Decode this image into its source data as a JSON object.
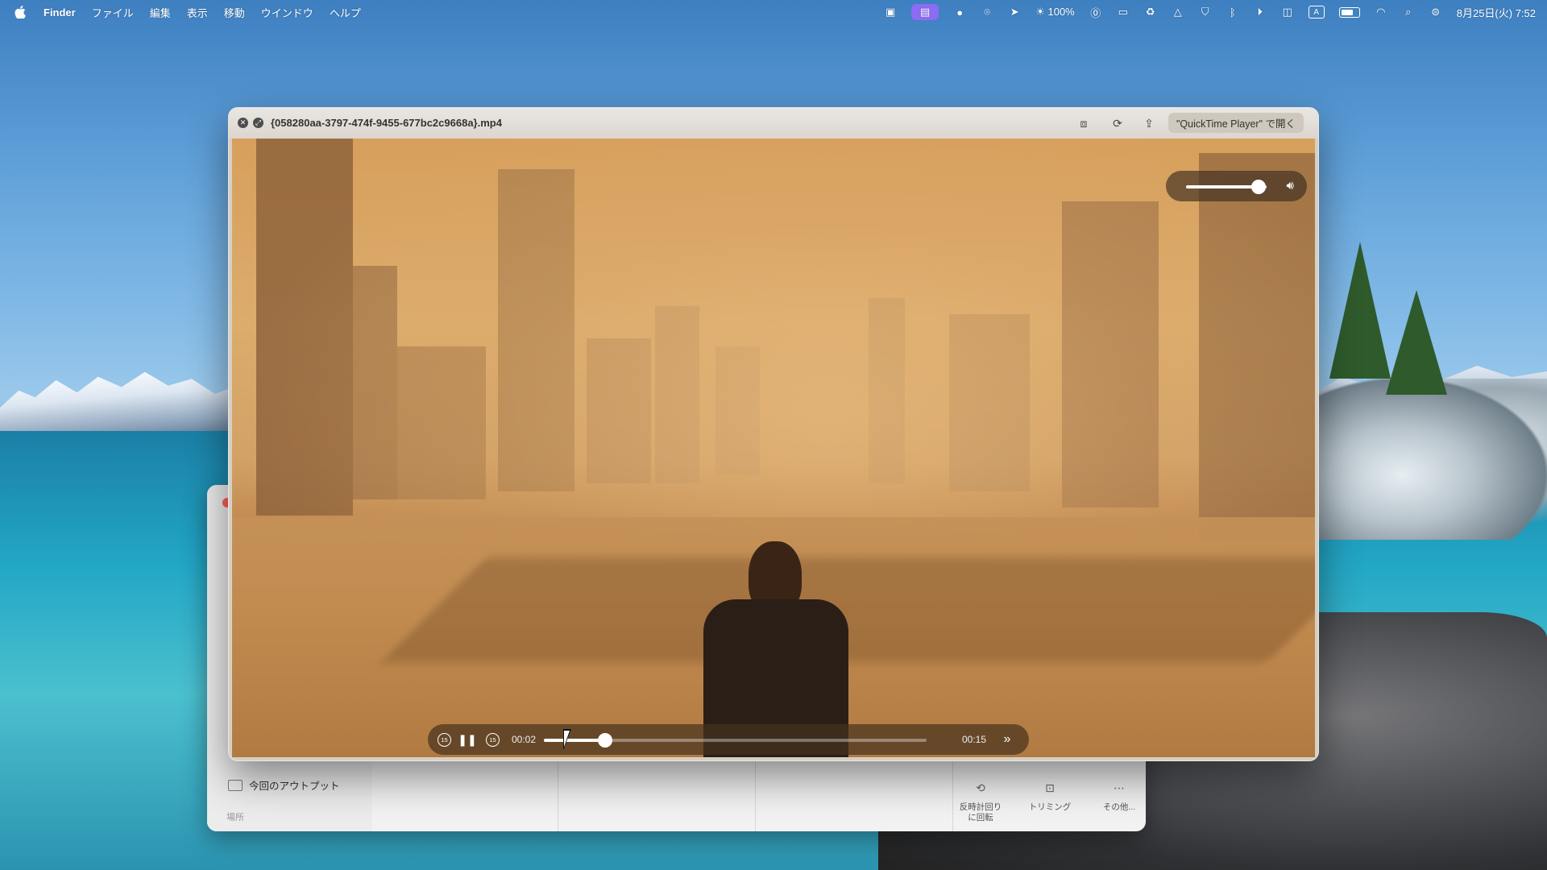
{
  "menubar": {
    "app_name": "Finder",
    "menus": [
      "ファイル",
      "編集",
      "表示",
      "移動",
      "ウインドウ",
      "ヘルプ"
    ],
    "brightness": "100%",
    "ime": "A",
    "datetime": "8月25日(火) 7:52"
  },
  "finder": {
    "sidebar_item": "今回のアウトプット",
    "sidebar_section": "場所",
    "tools": [
      {
        "label_line1": "反時計回り",
        "label_line2": "に回転",
        "icon": "rotate-left-icon"
      },
      {
        "label_line1": "トリミング",
        "label_line2": "",
        "icon": "trim-icon"
      },
      {
        "label_line1": "その他...",
        "label_line2": "",
        "icon": "more-icon"
      }
    ]
  },
  "player": {
    "filename": "{058280aa-3797-474f-9455-677bc2c9668a}.mp4",
    "open_with_label": "\"QuickTime Player\" で開く",
    "current_time": "00:02",
    "duration": "00:15",
    "progress": 0.16,
    "volume": 0.9,
    "playing": true,
    "skip_seconds": "15"
  }
}
